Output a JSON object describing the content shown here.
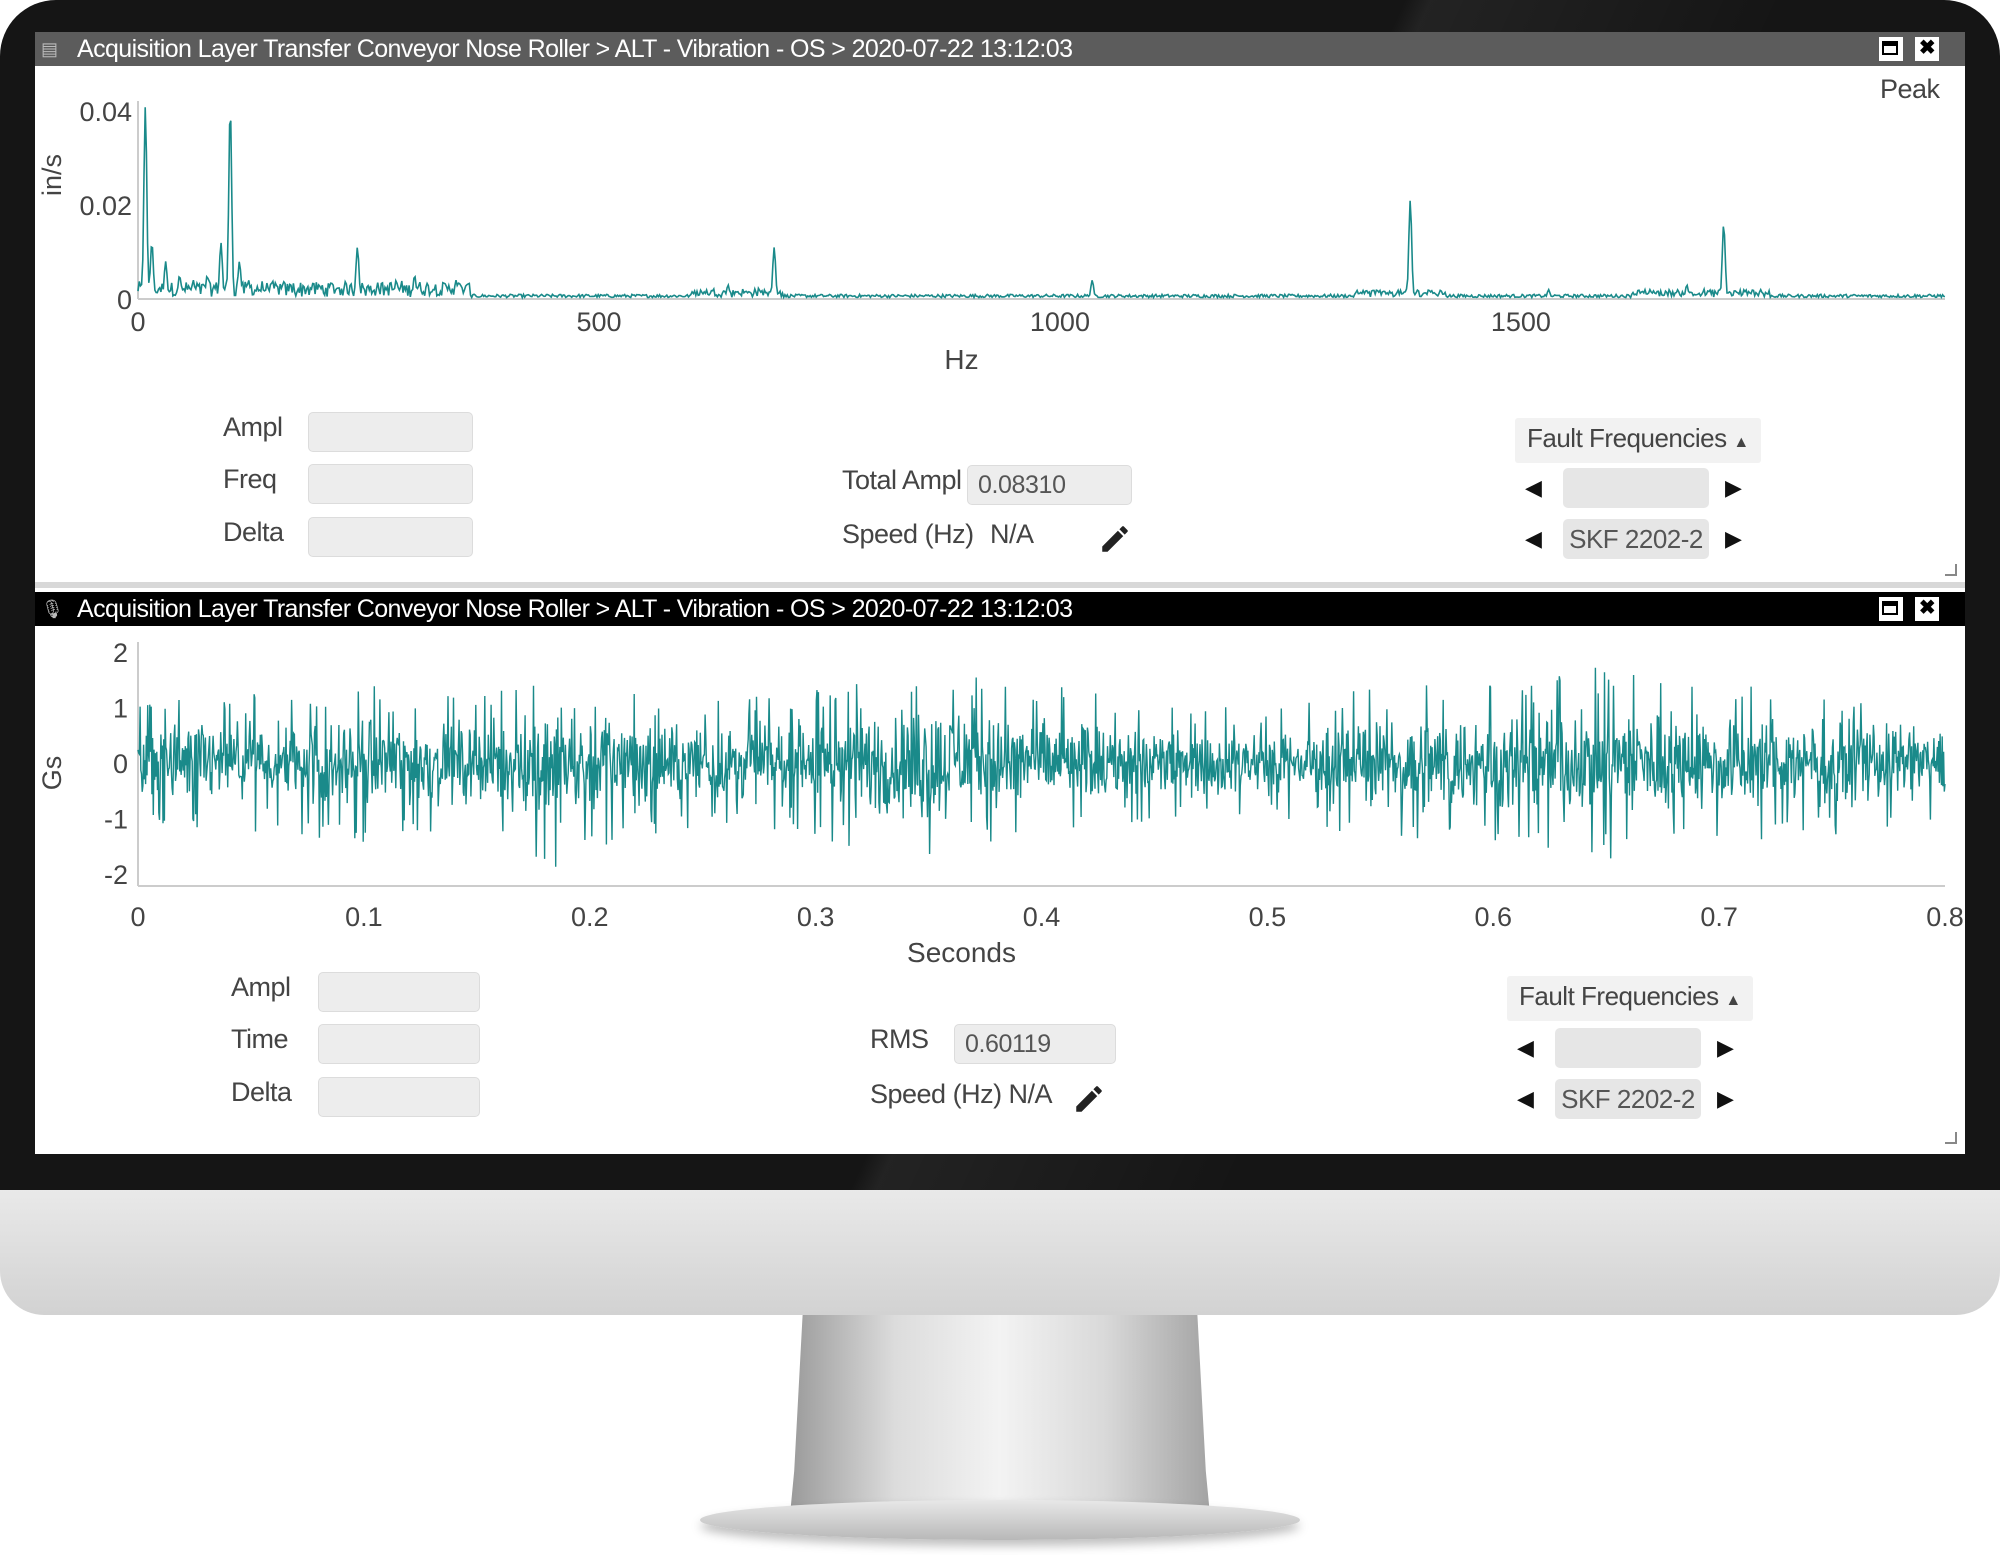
{
  "spectrum_window": {
    "title": "Acquisition Layer Transfer Conveyor Nose Roller > ALT - Vibration - OS > 2020-07-22 13:12:03",
    "peak_label": "Peak",
    "cursor_fields": [
      {
        "label": "Ampl",
        "value": ""
      },
      {
        "label": "Freq",
        "value": ""
      },
      {
        "label": "Delta",
        "value": ""
      }
    ],
    "total_ampl_label": "Total Ampl",
    "total_ampl_value": "0.08310",
    "speed_label": "Speed (Hz)",
    "speed_value": "N/A",
    "fault_frequencies_label": "Fault Frequencies",
    "fault_select_1": "",
    "fault_select_2": "SKF 2202-2"
  },
  "waveform_window": {
    "title": "Acquisition Layer Transfer Conveyor Nose Roller > ALT - Vibration - OS > 2020-07-22 13:12:03",
    "cursor_fields": [
      {
        "label": "Ampl",
        "value": ""
      },
      {
        "label": "Time",
        "value": ""
      },
      {
        "label": "Delta",
        "value": ""
      }
    ],
    "rms_label": "RMS",
    "rms_value": "0.60119",
    "speed_label": "Speed (Hz) N/A",
    "fault_frequencies_label": "Fault Frequencies",
    "fault_select_1": "",
    "fault_select_2": "SKF 2202-2"
  },
  "icons": [
    "chart-icon",
    "microphone-icon",
    "maximize-icon",
    "close-icon",
    "pencil-icon",
    "caret-up-icon",
    "arrow-left-icon",
    "arrow-right-icon"
  ],
  "colors": {
    "trace": "#1a8a8a",
    "titlebar_top": "#5c5c5c",
    "titlebar_bottom": "#000000"
  },
  "chart_data": [
    {
      "type": "line",
      "xlabel": "Hz",
      "ylabel": "in/s",
      "xlim": [
        0,
        1960
      ],
      "ylim": [
        0,
        0.04
      ],
      "xticks": [
        0,
        500,
        1000,
        1500
      ],
      "yticks": [
        0,
        0.02,
        0.04
      ],
      "ytick_labels": [
        "0",
        "0.02",
        "0.04"
      ],
      "grid": false,
      "legend": "top-right",
      "series": [
        {
          "name": "Peak",
          "peaks": [
            {
              "x": 8,
              "y": 0.041
            },
            {
              "x": 15,
              "y": 0.012
            },
            {
              "x": 30,
              "y": 0.008
            },
            {
              "x": 45,
              "y": 0.005
            },
            {
              "x": 60,
              "y": 0.004
            },
            {
              "x": 75,
              "y": 0.005
            },
            {
              "x": 90,
              "y": 0.012
            },
            {
              "x": 100,
              "y": 0.041
            },
            {
              "x": 110,
              "y": 0.008
            },
            {
              "x": 120,
              "y": 0.004
            },
            {
              "x": 140,
              "y": 0.003
            },
            {
              "x": 238,
              "y": 0.011
            },
            {
              "x": 260,
              "y": 0.003
            },
            {
              "x": 280,
              "y": 0.004
            },
            {
              "x": 300,
              "y": 0.005
            },
            {
              "x": 320,
              "y": 0.002
            },
            {
              "x": 345,
              "y": 0.004
            },
            {
              "x": 640,
              "y": 0.003
            },
            {
              "x": 690,
              "y": 0.011
            },
            {
              "x": 1035,
              "y": 0.004
            },
            {
              "x": 1340,
              "y": 0.002
            },
            {
              "x": 1380,
              "y": 0.021
            },
            {
              "x": 1400,
              "y": 0.002
            },
            {
              "x": 1530,
              "y": 0.002
            },
            {
              "x": 1640,
              "y": 0.002
            },
            {
              "x": 1680,
              "y": 0.003
            },
            {
              "x": 1720,
              "y": 0.016
            },
            {
              "x": 1760,
              "y": 0.002
            },
            {
              "x": 1960,
              "y": 0.0005
            }
          ]
        }
      ]
    },
    {
      "type": "line",
      "xlabel": "Seconds",
      "ylabel": "Gs",
      "xlim": [
        0,
        0.8
      ],
      "ylim": [
        -2,
        2
      ],
      "xticks": [
        0,
        0.1,
        0.2,
        0.3,
        0.4,
        0.5,
        0.6,
        0.7,
        0.8
      ],
      "xtick_labels": [
        "0",
        "0.1",
        "0.2",
        "0.3",
        "0.4",
        "0.5",
        "0.6",
        "0.7",
        "0.8"
      ],
      "yticks": [
        -2,
        -1,
        0,
        1,
        2
      ],
      "grid": false,
      "series": [
        {
          "name": "",
          "envelope": [
            {
              "x": 0.0,
              "amp": 1.0
            },
            {
              "x": 0.05,
              "amp": 1.2
            },
            {
              "x": 0.1,
              "amp": 1.3
            },
            {
              "x": 0.15,
              "amp": 1.1
            },
            {
              "x": 0.18,
              "amp": 1.8
            },
            {
              "x": 0.2,
              "amp": 1.5
            },
            {
              "x": 0.25,
              "amp": 1.0
            },
            {
              "x": 0.3,
              "amp": 1.2
            },
            {
              "x": 0.34,
              "amp": 1.7
            },
            {
              "x": 0.4,
              "amp": 1.3
            },
            {
              "x": 0.45,
              "amp": 1.0
            },
            {
              "x": 0.5,
              "amp": 0.9
            },
            {
              "x": 0.55,
              "amp": 1.3
            },
            {
              "x": 0.6,
              "amp": 1.4
            },
            {
              "x": 0.65,
              "amp": 1.6
            },
            {
              "x": 0.7,
              "amp": 1.3
            },
            {
              "x": 0.75,
              "amp": 1.2
            },
            {
              "x": 0.8,
              "amp": 0.9
            }
          ]
        }
      ]
    }
  ]
}
